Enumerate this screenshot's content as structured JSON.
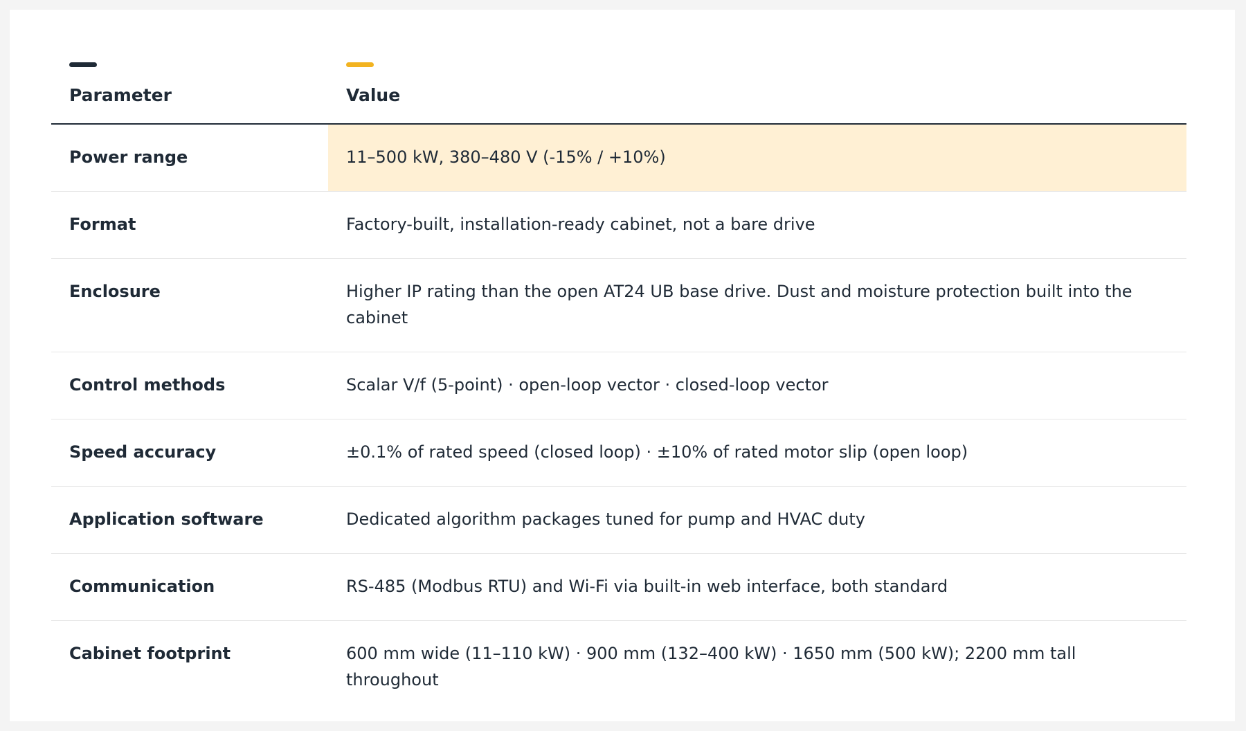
{
  "header": {
    "param_label": "Parameter",
    "value_label": "Value",
    "param_accent_color": "#1f2a36",
    "value_accent_color": "#f2b320"
  },
  "highlight_color": "#fff0d4",
  "rows": [
    {
      "param": "Power range",
      "value": "11–500 kW, 380–480 V (-15% / +10%)"
    },
    {
      "param": "Format",
      "value": "Factory-built, installation-ready cabinet, not a bare drive"
    },
    {
      "param": "Enclosure",
      "value": "Higher IP rating than the open AT24 UB base drive. Dust and moisture protection built into the cabinet"
    },
    {
      "param": "Control methods",
      "value": "Scalar V/f (5-point) · open-loop vector · closed-loop vector"
    },
    {
      "param": "Speed accuracy",
      "value": "±0.1% of rated speed (closed loop) · ±10% of rated motor slip (open loop)"
    },
    {
      "param": "Application software",
      "value": "Dedicated algorithm packages tuned for pump and HVAC duty"
    },
    {
      "param": "Communication",
      "value": "RS-485 (Modbus RTU) and Wi-Fi via built-in web interface, both standard"
    },
    {
      "param": "Cabinet footprint",
      "value": "600 mm wide (11–110 kW) · 900 mm (132–400 kW) · 1650 mm (500 kW); 2200 mm tall throughout"
    }
  ]
}
